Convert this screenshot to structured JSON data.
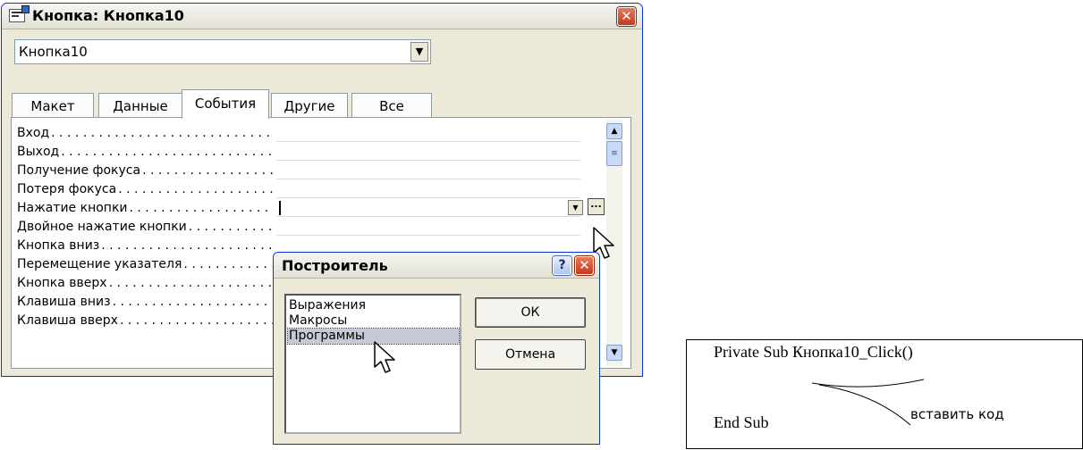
{
  "window": {
    "title": "Кнопка: Кнопка10",
    "close_glyph": "✕",
    "object_select": {
      "value": "Кнопка10",
      "arrow": "▼"
    },
    "tabs": [
      {
        "label": "Макет",
        "active": false
      },
      {
        "label": "Данные",
        "active": false
      },
      {
        "label": "События",
        "active": true
      },
      {
        "label": "Другие",
        "active": false
      },
      {
        "label": "Все",
        "active": false
      }
    ],
    "properties": [
      {
        "label": "Вход",
        "value": ""
      },
      {
        "label": "Выход",
        "value": ""
      },
      {
        "label": "Получение фокуса",
        "value": ""
      },
      {
        "label": "Потеря фокуса",
        "value": ""
      },
      {
        "label": "Нажатие кнопки",
        "value": ""
      },
      {
        "label": "Двойное нажатие кнопки",
        "value": ""
      },
      {
        "label": "Кнопка вниз",
        "value": ""
      },
      {
        "label": "Перемещение указателя",
        "value": ""
      },
      {
        "label": "Кнопка вверх",
        "value": ""
      },
      {
        "label": "Клавиша вниз",
        "value": ""
      },
      {
        "label": "Клавиша вверх",
        "value": ""
      }
    ],
    "leader_dots": ". . . . . . . . . . . . . . . . . . . . . . . . . . . . . . . . . . . . . . . . . . . . . . . . .",
    "builder_button_glyph": "...",
    "dropdown_glyph": "▼",
    "scroll_up_glyph": "▲",
    "scroll_down_glyph": "▼",
    "scroll_thumb_glyph": "≡"
  },
  "builder_dialog": {
    "title": "Построитель",
    "help_glyph": "?",
    "close_glyph": "✕",
    "options": [
      {
        "label": "Выражения",
        "selected": false
      },
      {
        "label": "Макросы",
        "selected": false
      },
      {
        "label": "Программы",
        "selected": true
      }
    ],
    "ok_label": "ОК",
    "cancel_label": "Отмена"
  },
  "code_note": {
    "line1": "Private Sub Кнопка10_Click()",
    "line2": "End Sub",
    "annotation": "вставить код"
  },
  "colors": {
    "window_bg": "#ece9d8",
    "title_border": "#0831d9",
    "close_red": "#c43a1a",
    "selection": "#c6c9d6"
  }
}
